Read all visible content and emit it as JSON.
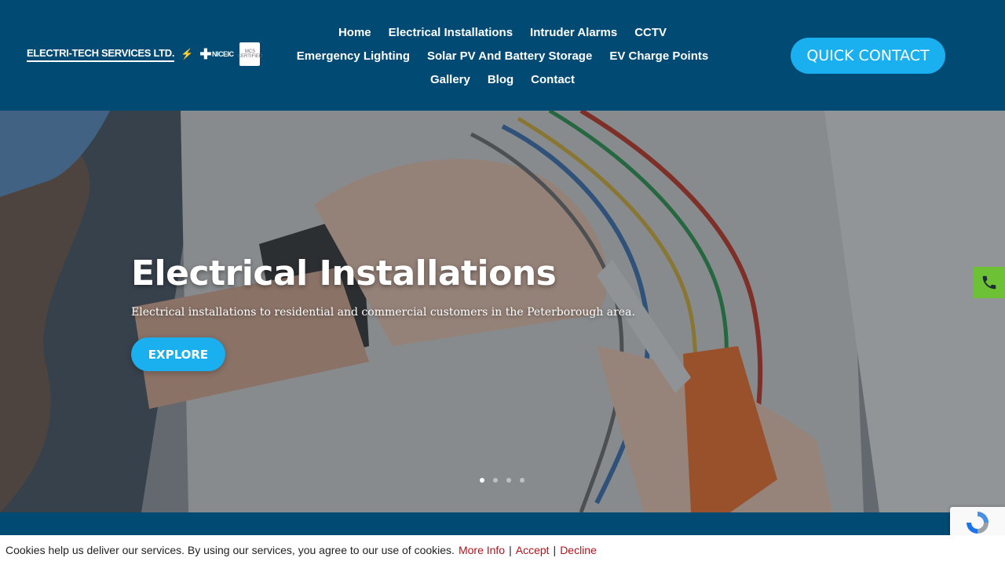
{
  "logo": {
    "company_text": "ELECTRI-TECH SERVICES LTD.",
    "niceic_text": "NICEIC",
    "mcs_text": "MCS",
    "mcs_sub": "CERTIFIED"
  },
  "nav": {
    "row1": [
      "Home",
      "Electrical Installations",
      "Intruder Alarms",
      "CCTV"
    ],
    "row2": [
      "Emergency Lighting",
      "Solar PV And Battery Storage",
      "EV Charge Points"
    ],
    "row3": [
      "Gallery",
      "Blog",
      "Contact"
    ]
  },
  "header": {
    "quick_contact_label": "QUICK CONTACT"
  },
  "hero": {
    "title": "Electrical Installations",
    "subtitle": "Electrical installations to residential and commercial customers in the Peterborough area.",
    "button_label": "EXPLORE",
    "slide_count": 4,
    "active_slide": 1
  },
  "cookie": {
    "message": "Cookies help us deliver our services. By using our services, you agree to our use of cookies.",
    "more_info": "More Info",
    "accept": "Accept",
    "decline": "Decline",
    "separator": "|"
  },
  "icons": {
    "phone": "phone-icon",
    "recaptcha": "recaptcha-icon"
  },
  "colors": {
    "header_bg": "#004a73",
    "accent": "#1ab0ef",
    "phone_tab": "#6cc134",
    "cookie_link": "#b5121b"
  }
}
